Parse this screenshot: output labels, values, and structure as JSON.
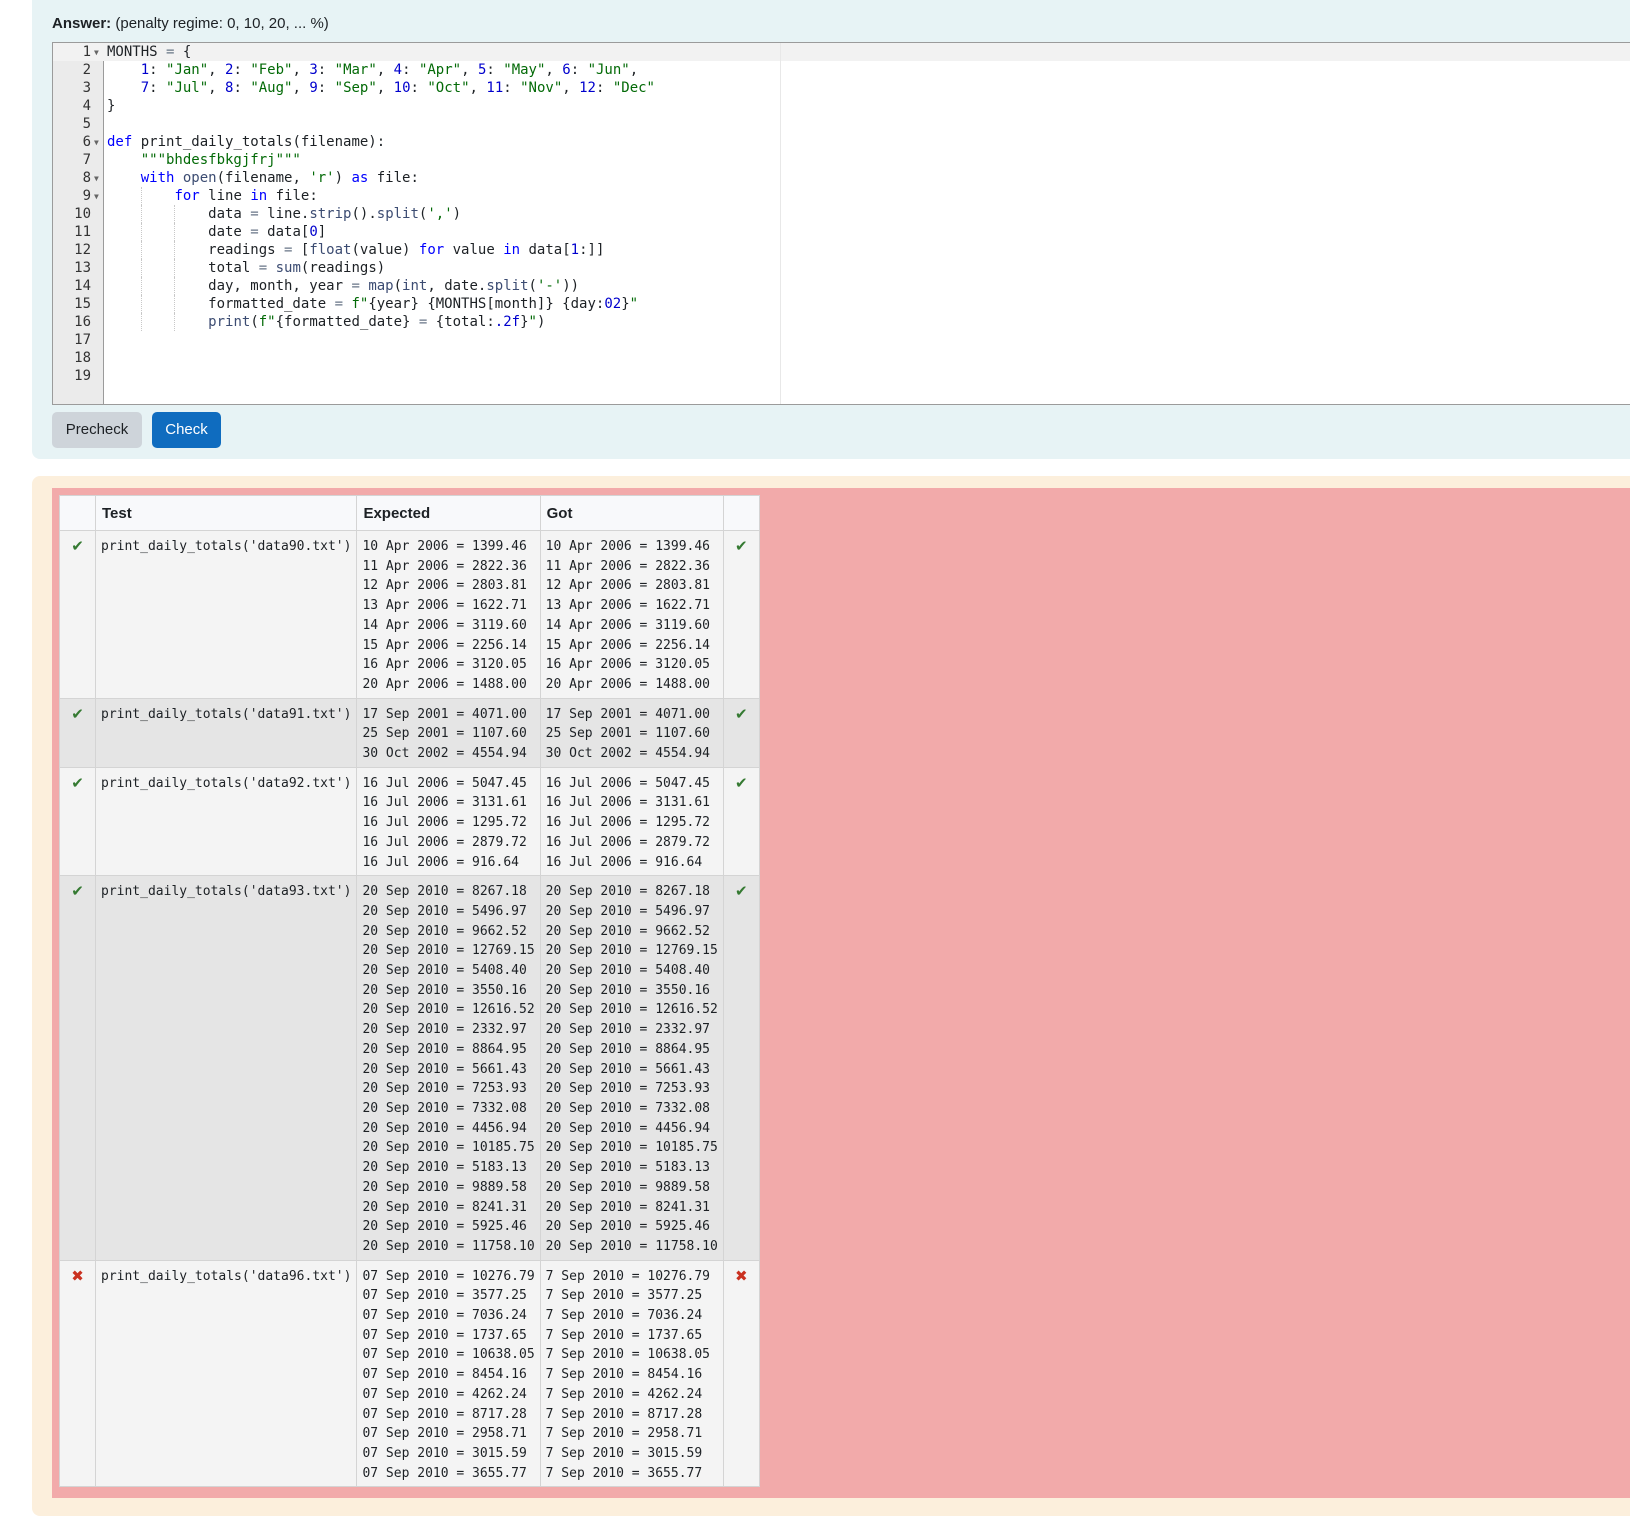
{
  "answer": {
    "label": "Answer:",
    "penalty": "(penalty regime: 0, 10, 20, ... %)"
  },
  "editor": {
    "lines": [
      {
        "num": "1",
        "fold": true,
        "html": "MONTHS <span class=\"o\">=</span> {"
      },
      {
        "num": "2",
        "fold": false,
        "html": "    <span class=\"n\">1</span>: <span class=\"s\">\"Jan\"</span>, <span class=\"n\">2</span>: <span class=\"s\">\"Feb\"</span>, <span class=\"n\">3</span>: <span class=\"s\">\"Mar\"</span>, <span class=\"n\">4</span>: <span class=\"s\">\"Apr\"</span>, <span class=\"n\">5</span>: <span class=\"s\">\"May\"</span>, <span class=\"n\">6</span>: <span class=\"s\">\"Jun\"</span>,"
      },
      {
        "num": "3",
        "fold": false,
        "html": "    <span class=\"n\">7</span>: <span class=\"s\">\"Jul\"</span>, <span class=\"n\">8</span>: <span class=\"s\">\"Aug\"</span>, <span class=\"n\">9</span>: <span class=\"s\">\"Sep\"</span>, <span class=\"n\">10</span>: <span class=\"s\">\"Oct\"</span>, <span class=\"n\">11</span>: <span class=\"s\">\"Nov\"</span>, <span class=\"n\">12</span>: <span class=\"s\">\"Dec\"</span>"
      },
      {
        "num": "4",
        "fold": false,
        "html": "}"
      },
      {
        "num": "5",
        "fold": false,
        "html": ""
      },
      {
        "num": "6",
        "fold": true,
        "html": "<span class=\"k\">def</span> print_daily_totals(filename):"
      },
      {
        "num": "7",
        "fold": false,
        "html": "    <span class=\"s\">\"\"\"bhdesfbkgjfrj\"\"\"</span>"
      },
      {
        "num": "8",
        "fold": true,
        "html": "    <span class=\"k\">with</span> <span class=\"f\">open</span>(filename, <span class=\"s\">'r'</span>) <span class=\"k\">as</span> file:"
      },
      {
        "num": "9",
        "fold": true,
        "html": "        <span class=\"k\">for</span> line <span class=\"k\">in</span> file:"
      },
      {
        "num": "10",
        "fold": false,
        "html": "            data <span class=\"o\">=</span> line.<span class=\"f\">strip</span>().<span class=\"f\">split</span>(<span class=\"s\">','</span>)"
      },
      {
        "num": "11",
        "fold": false,
        "html": "            date <span class=\"o\">=</span> data[<span class=\"n\">0</span>]"
      },
      {
        "num": "12",
        "fold": false,
        "html": "            readings <span class=\"o\">=</span> [<span class=\"f\">float</span>(value) <span class=\"k\">for</span> value <span class=\"k\">in</span> data[<span class=\"n\">1</span>:]]"
      },
      {
        "num": "13",
        "fold": false,
        "html": "            total <span class=\"o\">=</span> <span class=\"f\">sum</span>(readings)"
      },
      {
        "num": "14",
        "fold": false,
        "html": "            day, month, year <span class=\"o\">=</span> <span class=\"f\">map</span>(<span class=\"f\">int</span>, date.<span class=\"f\">split</span>(<span class=\"s\">'-'</span>))"
      },
      {
        "num": "15",
        "fold": false,
        "html": "            formatted_date <span class=\"o\">=</span> <span class=\"s\">f\"</span>{year} {MONTHS[month]} {day:<span class=\"n\">02</span>}<span class=\"s\">\"</span>"
      },
      {
        "num": "16",
        "fold": false,
        "html": "            <span class=\"f\">print</span>(<span class=\"s\">f\"</span>{formatted_date} <span class=\"o\">=</span> {total:<span class=\"n\">.2f</span>}<span class=\"s\">\"</span>)"
      },
      {
        "num": "17",
        "fold": false,
        "html": ""
      },
      {
        "num": "18",
        "fold": false,
        "html": ""
      },
      {
        "num": "19",
        "fold": false,
        "html": ""
      }
    ]
  },
  "buttons": {
    "precheck": "Precheck",
    "check": "Check"
  },
  "results": {
    "headers": [
      "",
      "Test",
      "Expected",
      "Got",
      ""
    ],
    "rows": [
      {
        "pass": true,
        "test": "print_daily_totals('data90.txt')",
        "expected": "10 Apr 2006 = 1399.46\n11 Apr 2006 = 2822.36\n12 Apr 2006 = 2803.81\n13 Apr 2006 = 1622.71\n14 Apr 2006 = 3119.60\n15 Apr 2006 = 2256.14\n16 Apr 2006 = 3120.05\n20 Apr 2006 = 1488.00",
        "got": "10 Apr 2006 = 1399.46\n11 Apr 2006 = 2822.36\n12 Apr 2006 = 2803.81\n13 Apr 2006 = 1622.71\n14 Apr 2006 = 3119.60\n15 Apr 2006 = 2256.14\n16 Apr 2006 = 3120.05\n20 Apr 2006 = 1488.00"
      },
      {
        "pass": true,
        "test": "print_daily_totals('data91.txt')",
        "expected": "17 Sep 2001 = 4071.00\n25 Sep 2001 = 1107.60\n30 Oct 2002 = 4554.94",
        "got": "17 Sep 2001 = 4071.00\n25 Sep 2001 = 1107.60\n30 Oct 2002 = 4554.94"
      },
      {
        "pass": true,
        "test": "print_daily_totals('data92.txt')",
        "expected": "16 Jul 2006 = 5047.45\n16 Jul 2006 = 3131.61\n16 Jul 2006 = 1295.72\n16 Jul 2006 = 2879.72\n16 Jul 2006 = 916.64",
        "got": "16 Jul 2006 = 5047.45\n16 Jul 2006 = 3131.61\n16 Jul 2006 = 1295.72\n16 Jul 2006 = 2879.72\n16 Jul 2006 = 916.64"
      },
      {
        "pass": true,
        "test": "print_daily_totals('data93.txt')",
        "expected": "20 Sep 2010 = 8267.18\n20 Sep 2010 = 5496.97\n20 Sep 2010 = 9662.52\n20 Sep 2010 = 12769.15\n20 Sep 2010 = 5408.40\n20 Sep 2010 = 3550.16\n20 Sep 2010 = 12616.52\n20 Sep 2010 = 2332.97\n20 Sep 2010 = 8864.95\n20 Sep 2010 = 5661.43\n20 Sep 2010 = 7253.93\n20 Sep 2010 = 7332.08\n20 Sep 2010 = 4456.94\n20 Sep 2010 = 10185.75\n20 Sep 2010 = 5183.13\n20 Sep 2010 = 9889.58\n20 Sep 2010 = 8241.31\n20 Sep 2010 = 5925.46\n20 Sep 2010 = 11758.10",
        "got": "20 Sep 2010 = 8267.18\n20 Sep 2010 = 5496.97\n20 Sep 2010 = 9662.52\n20 Sep 2010 = 12769.15\n20 Sep 2010 = 5408.40\n20 Sep 2010 = 3550.16\n20 Sep 2010 = 12616.52\n20 Sep 2010 = 2332.97\n20 Sep 2010 = 8864.95\n20 Sep 2010 = 5661.43\n20 Sep 2010 = 7253.93\n20 Sep 2010 = 7332.08\n20 Sep 2010 = 4456.94\n20 Sep 2010 = 10185.75\n20 Sep 2010 = 5183.13\n20 Sep 2010 = 9889.58\n20 Sep 2010 = 8241.31\n20 Sep 2010 = 5925.46\n20 Sep 2010 = 11758.10"
      },
      {
        "pass": false,
        "test": "print_daily_totals('data96.txt')",
        "expected": "07 Sep 2010 = 10276.79\n07 Sep 2010 = 3577.25\n07 Sep 2010 = 7036.24\n07 Sep 2010 = 1737.65\n07 Sep 2010 = 10638.05\n07 Sep 2010 = 8454.16\n07 Sep 2010 = 4262.24\n07 Sep 2010 = 8717.28\n07 Sep 2010 = 2958.71\n07 Sep 2010 = 3015.59\n07 Sep 2010 = 3655.77",
        "got": "7 Sep 2010 = 10276.79\n7 Sep 2010 = 3577.25\n7 Sep 2010 = 7036.24\n7 Sep 2010 = 1737.65\n7 Sep 2010 = 10638.05\n7 Sep 2010 = 8454.16\n7 Sep 2010 = 4262.24\n7 Sep 2010 = 8717.28\n7 Sep 2010 = 2958.71\n7 Sep 2010 = 3015.59\n7 Sep 2010 = 3655.77"
      }
    ],
    "pass_symbol": "✔",
    "fail_symbol": "✖"
  }
}
